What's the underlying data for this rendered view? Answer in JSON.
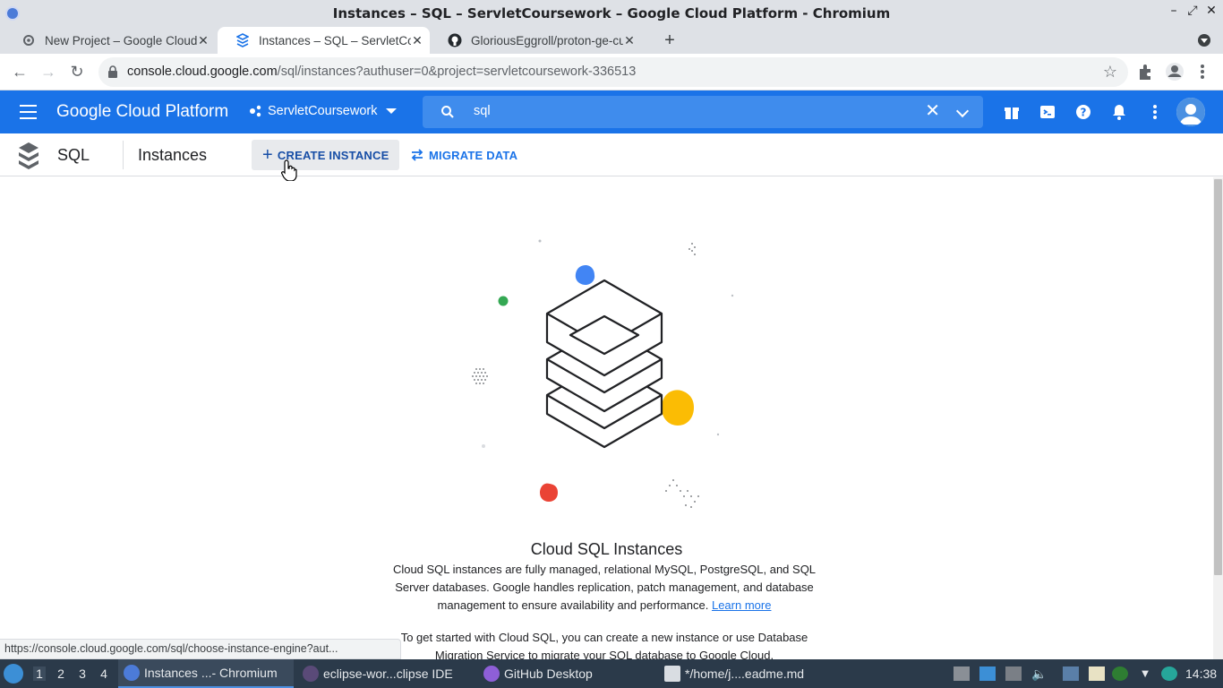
{
  "window": {
    "title": "Instances – SQL – ServletCoursework – Google Cloud Platform - Chromium"
  },
  "tabs": [
    {
      "label": "New Project – Google Cloud Platform",
      "active": false
    },
    {
      "label": "Instances – SQL – ServletCoursework",
      "active": true
    },
    {
      "label": "GloriousEggroll/proton-ge-custom",
      "active": false
    }
  ],
  "toolbar": {
    "url_host": "console.cloud.google.com",
    "url_path": "/sql/instances?authuser=0&project=servletcoursework-336513"
  },
  "gcp_header": {
    "brand": "Google Cloud Platform",
    "project": "ServletCoursework",
    "search_value": "sql"
  },
  "product_bar": {
    "product_name": "SQL",
    "page_title": "Instances",
    "create_label": "CREATE INSTANCE",
    "migrate_label": "MIGRATE DATA"
  },
  "empty_state": {
    "title": "Cloud SQL Instances",
    "description": "Cloud SQL instances are fully managed, relational MySQL, PostgreSQL, and SQL Server databases. Google handles replication, patch management, and database management to ensure availability and performance.",
    "learn_more": "Learn more",
    "get_started": "To get started with Cloud SQL, you can create a new instance or use Database Migration Service to migrate your SQL database to Google Cloud."
  },
  "status_url": "https://console.cloud.google.com/sql/choose-instance-engine?aut...",
  "taskbar": {
    "workspaces": [
      "1",
      "2",
      "3",
      "4"
    ],
    "tasks": [
      {
        "label": "Instances ...- Chromium",
        "active": true
      },
      {
        "label": "eclipse-wor...clipse IDE",
        "active": false
      },
      {
        "label": "GitHub Desktop",
        "active": false
      },
      {
        "label": "*/home/j....eadme.md",
        "active": false
      }
    ],
    "clock": "14:38"
  },
  "colors": {
    "gcp_blue": "#1a73e8",
    "illus_blue": "#4285f4",
    "illus_green": "#34a853",
    "illus_yellow": "#fbbc04",
    "illus_red": "#ea4335"
  }
}
